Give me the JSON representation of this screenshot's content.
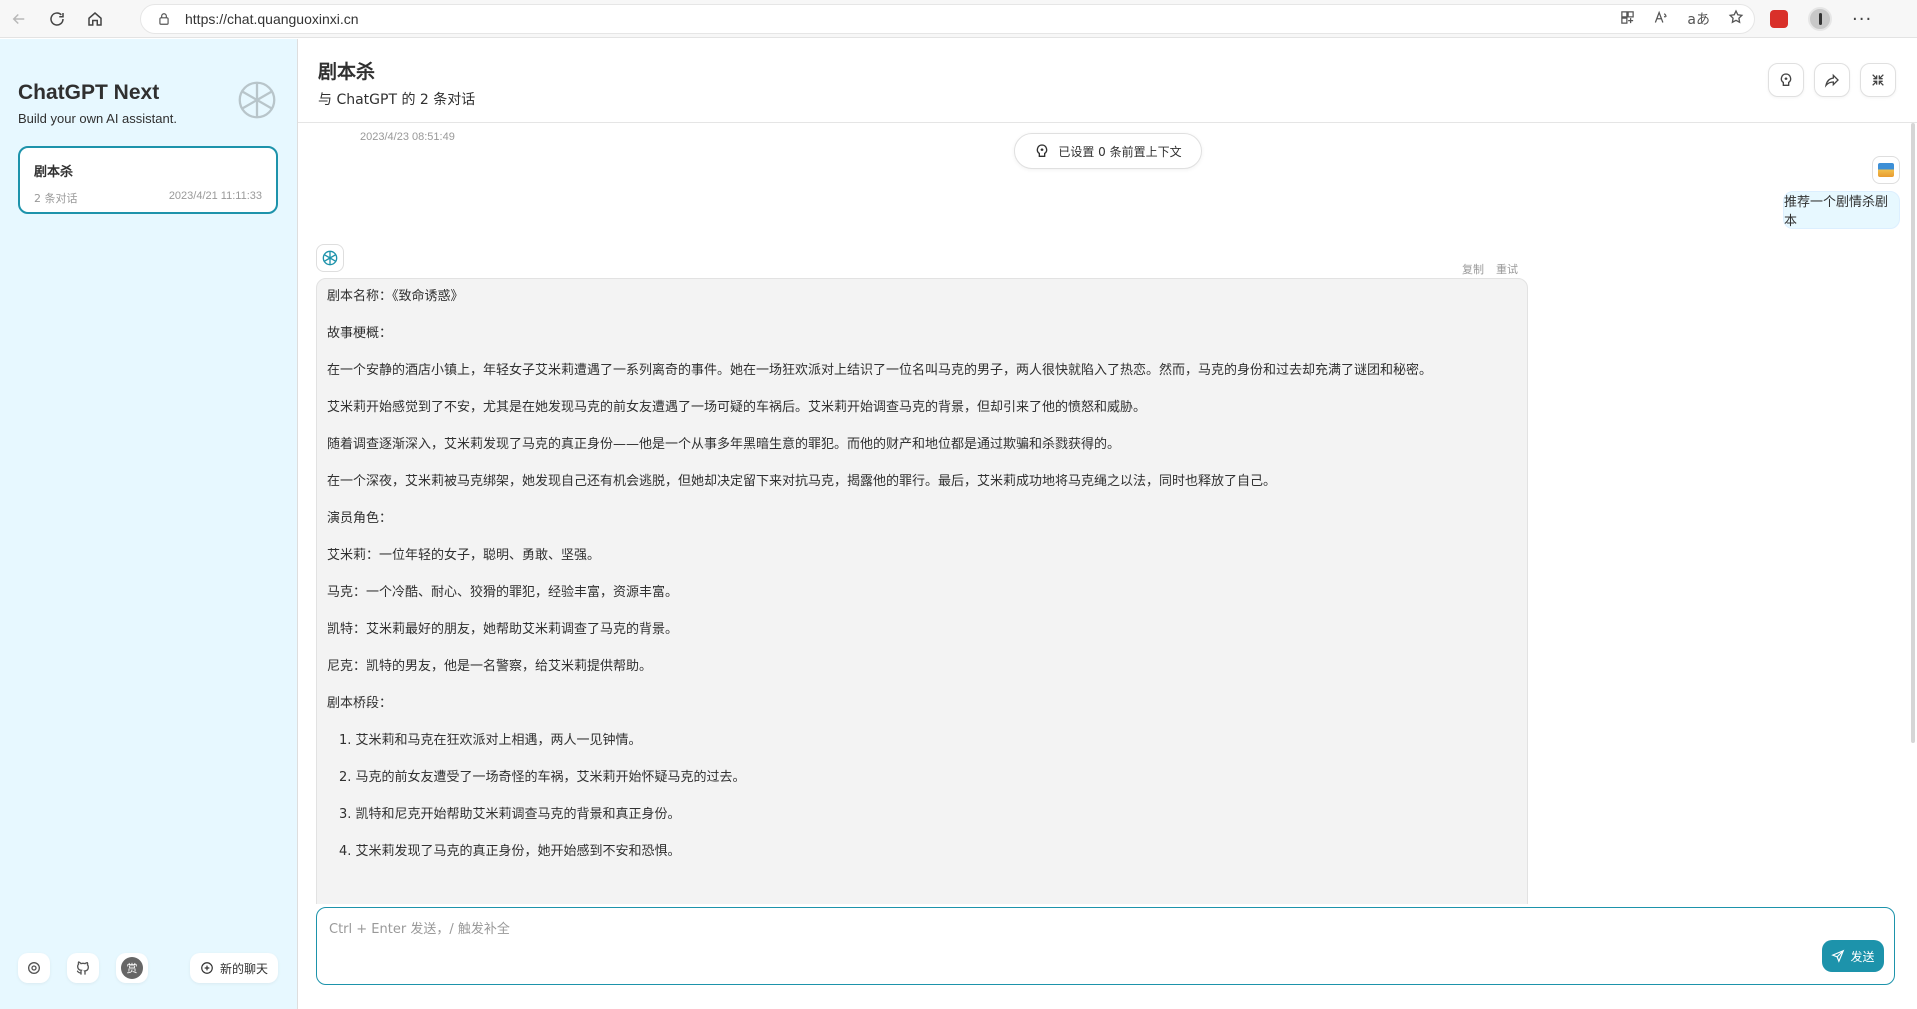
{
  "browser": {
    "url": "https://chat.quanguoxinxi.cn",
    "ext_text": "aあ"
  },
  "sidebar": {
    "title": "ChatGPT Next",
    "subtitle": "Build your own AI assistant.",
    "chats": [
      {
        "title": "剧本杀",
        "count": "2 条对话",
        "date": "2023/4/21 11:11:33"
      }
    ],
    "reward_label": "赏",
    "new_chat_label": "新的聊天"
  },
  "header": {
    "title": "剧本杀",
    "subtitle": "与 ChatGPT 的 2 条对话"
  },
  "chat": {
    "top_date": "2023/4/23 08:51:49",
    "context_label": "已设置 0 条前置上下文",
    "user_message": "推荐一个剧情杀剧本",
    "actions": {
      "copy": "复制",
      "retry": "重试"
    },
    "bot_paragraphs": [
      "剧本名称：《致命诱惑》",
      "故事梗概：",
      "在一个安静的酒店小镇上，年轻女子艾米莉遭遇了一系列离奇的事件。她在一场狂欢派对上结识了一位名叫马克的男子，两人很快就陷入了热恋。然而，马克的身份和过去却充满了谜团和秘密。",
      "艾米莉开始感觉到了不安，尤其是在她发现马克的前女友遭遇了一场可疑的车祸后。艾米莉开始调查马克的背景，但却引来了他的愤怒和威胁。",
      "随着调查逐渐深入，艾米莉发现了马克的真正身份——他是一个从事多年黑暗生意的罪犯。而他的财产和地位都是通过欺骗和杀戮获得的。",
      "在一个深夜，艾米莉被马克绑架，她发现自己还有机会逃脱，但她却决定留下来对抗马克，揭露他的罪行。最后，艾米莉成功地将马克绳之以法，同时也释放了自己。",
      "演员角色：",
      "艾米莉：一位年轻的女子，聪明、勇敢、坚强。",
      "马克：一个冷酷、耐心、狡猾的罪犯，经验丰富，资源丰富。",
      "凯特：艾米莉最好的朋友，她帮助艾米莉调查了马克的背景。",
      "尼克：凯特的男友，他是一名警察，给艾米莉提供帮助。",
      "剧本桥段："
    ],
    "bot_list": [
      "1. 艾米莉和马克在狂欢派对上相遇，两人一见钟情。",
      "2. 马克的前女友遭受了一场奇怪的车祸，艾米莉开始怀疑马克的过去。",
      "3. 凯特和尼克开始帮助艾米莉调查马克的背景和真正身份。",
      "4. 艾米莉发现了马克的真正身份，她开始感到不安和恐惧。"
    ]
  },
  "input": {
    "placeholder": "Ctrl + Enter 发送，/ 触发补全",
    "send_label": "发送"
  },
  "colors": {
    "accent": "#1d93ab",
    "sidebar_bg": "#e7f8ff",
    "bot_bubble": "#f3f3f3"
  }
}
